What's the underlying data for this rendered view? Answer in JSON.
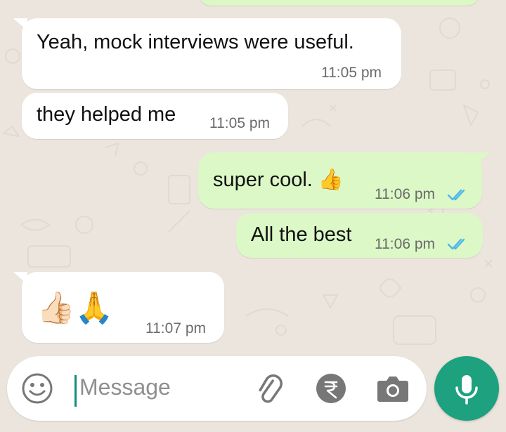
{
  "chat": {
    "messages": [
      {
        "direction": "in",
        "text": "Yeah, mock interviews were useful.",
        "time": "11:05 pm"
      },
      {
        "direction": "in",
        "text": "they helped me",
        "time": "11:05 pm"
      },
      {
        "direction": "out",
        "text": "super cool. 👍",
        "time": "11:06 pm",
        "status": "read"
      },
      {
        "direction": "out",
        "text": "All the best",
        "time": "11:06 pm",
        "status": "read"
      },
      {
        "direction": "in",
        "text": "👍🏻🙏",
        "time": "11:07 pm"
      }
    ]
  },
  "composer": {
    "placeholder": "Message",
    "icons": {
      "emoji": "emoji-icon",
      "attach": "paperclip-icon",
      "payment": "rupee-icon",
      "camera": "camera-icon",
      "mic": "microphone-icon"
    }
  },
  "colors": {
    "wallpaper": "#ECE5DD",
    "incoming_bubble": "#FFFFFF",
    "outgoing_bubble": "#DCF8C6",
    "read_tick": "#4FB6EC",
    "accent": "#1DA17F"
  }
}
